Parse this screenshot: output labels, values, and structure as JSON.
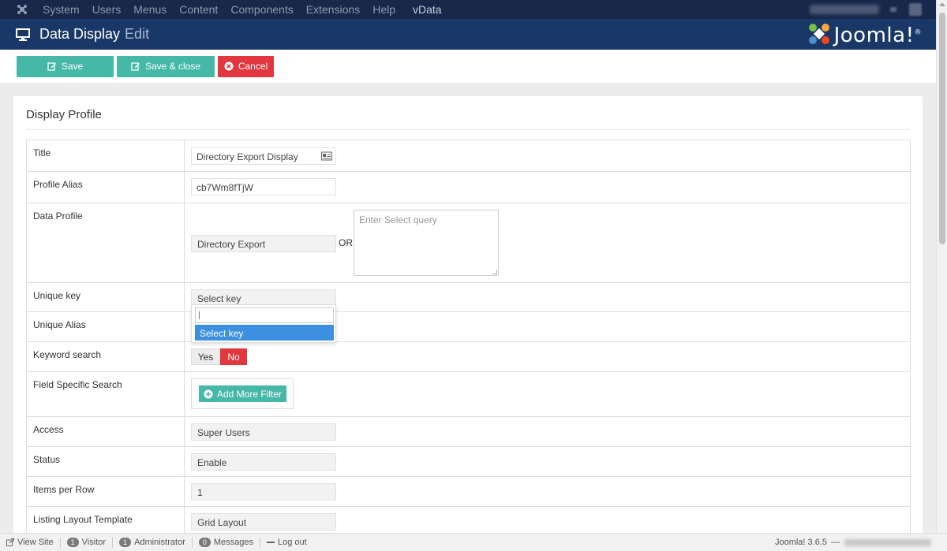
{
  "topnav": {
    "items": [
      "System",
      "Users",
      "Menus",
      "Content",
      "Components",
      "Extensions",
      "Help"
    ],
    "extra": "vData"
  },
  "header": {
    "title": "Data Display",
    "subtitle": "Edit",
    "brand": "Joomla!",
    "brand_mark": "®"
  },
  "toolbar": {
    "save": "Save",
    "save_close": "Save & close",
    "cancel": "Cancel"
  },
  "section": {
    "title": "Display Profile"
  },
  "form": {
    "title_label": "Title",
    "title_value": "Directory Export Display",
    "alias_label": "Profile Alias",
    "alias_value": "cb7Wm8fTjW",
    "data_profile_label": "Data Profile",
    "data_profile_value": "Directory Export",
    "or_text": "OR",
    "query_placeholder": "Enter Select query",
    "unique_key_label": "Unique key",
    "unique_key_value": "Select key",
    "unique_alias_label": "Unique Alias",
    "keyword_label": "Keyword search",
    "keyword_yes": "Yes",
    "keyword_no": "No",
    "keyword_selected": "No",
    "field_search_label": "Field Specific Search",
    "add_filter": "Add More Filter",
    "access_label": "Access",
    "access_value": "Super Users",
    "status_label": "Status",
    "status_value": "Enable",
    "items_label": "Items per Row",
    "items_value": "1",
    "layout_label": "Listing Layout Template",
    "layout_value": "Grid Layout"
  },
  "dropdown": {
    "search_value": "",
    "option": "Select key"
  },
  "statusbar": {
    "view_site": "View Site",
    "visitor_count": "1",
    "visitor": "Visitor",
    "admin_count": "1",
    "admin": "Administrator",
    "messages_count": "0",
    "messages": "Messages",
    "logout": "Log out",
    "version": "Joomla! 3.6.5",
    "separator": "—"
  },
  "colors": {
    "topnav": "#17284a",
    "header": "#1a3867",
    "green": "#46b8a8",
    "red": "#e0383e",
    "select_blue": "#3d8fe0"
  }
}
